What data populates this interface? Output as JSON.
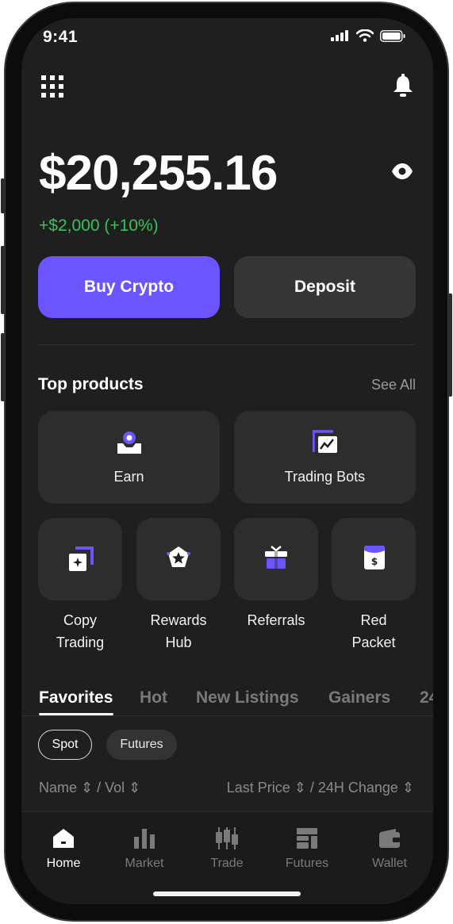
{
  "status": {
    "time": "9:41"
  },
  "header": {
    "menu_icon": "grid-icon",
    "bell_icon": "bell-icon"
  },
  "balance": {
    "amount": "$20,255.16",
    "change": "+$2,000 (+10%)",
    "eye_icon": "eye-icon"
  },
  "actions": {
    "buy_label": "Buy Crypto",
    "deposit_label": "Deposit"
  },
  "top_products": {
    "title": "Top products",
    "see_all": "See All",
    "large": [
      {
        "label": "Earn",
        "icon": "earn-icon"
      },
      {
        "label": "Trading Bots",
        "icon": "trading-bots-icon"
      }
    ],
    "small": [
      {
        "line1": "Copy",
        "line2": "Trading",
        "icon": "copy-trading-icon"
      },
      {
        "line1": "Rewards",
        "line2": "Hub",
        "icon": "rewards-icon"
      },
      {
        "line1": "Referrals",
        "line2": "",
        "icon": "gift-icon"
      },
      {
        "line1": "Red",
        "line2": "Packet",
        "icon": "red-packet-icon"
      }
    ]
  },
  "tabs": [
    "Favorites",
    "Hot",
    "New Listings",
    "Gainers",
    "24"
  ],
  "chips": {
    "spot": "Spot",
    "futures": "Futures"
  },
  "columns": {
    "left": "Name ⇕ / Vol ⇕",
    "right": "Last Price ⇕ / 24H Change ⇕"
  },
  "nav": [
    {
      "label": "Home",
      "icon": "home-icon"
    },
    {
      "label": "Market",
      "icon": "market-icon"
    },
    {
      "label": "Trade",
      "icon": "trade-icon"
    },
    {
      "label": "Futures",
      "icon": "futures-icon"
    },
    {
      "label": "Wallet",
      "icon": "wallet-icon"
    }
  ],
  "colors": {
    "accent": "#6b55ff",
    "positive": "#35c45a",
    "background": "#1f1f1f",
    "card": "#2d2d2d"
  }
}
